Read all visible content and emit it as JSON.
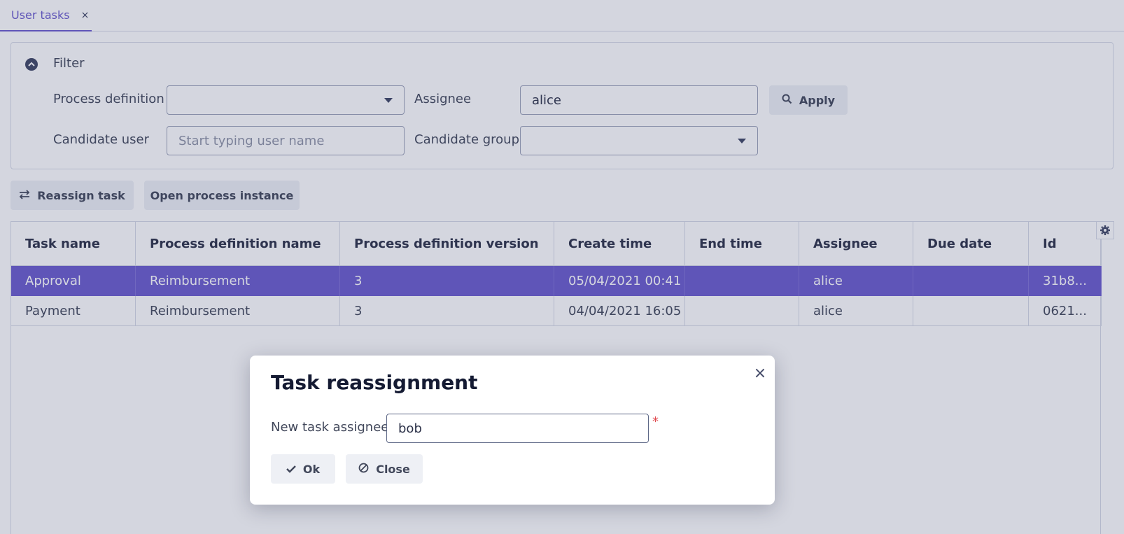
{
  "tabs": [
    {
      "label": "User tasks",
      "close": "×"
    }
  ],
  "filter": {
    "title": "Filter",
    "process_definition": {
      "label": "Process definition",
      "value": ""
    },
    "assignee": {
      "label": "Assignee",
      "value": "alice"
    },
    "apply_label": "Apply",
    "candidate_user": {
      "label": "Candidate user",
      "placeholder": "Start typing user name"
    },
    "candidate_group": {
      "label": "Candidate group",
      "value": ""
    }
  },
  "toolbar": {
    "reassign_label": "Reassign task",
    "open_instance_label": "Open process instance"
  },
  "table": {
    "columns": [
      "Task name",
      "Process definition name",
      "Process definition version",
      "Create time",
      "End time",
      "Assignee",
      "Due date",
      "Id"
    ],
    "rows": [
      [
        "Approval",
        "Reimbursement",
        "3",
        "05/04/2021 00:41",
        "",
        "alice",
        "",
        "31b8..."
      ],
      [
        "Payment",
        "Reimbursement",
        "3",
        "04/04/2021 16:05",
        "",
        "alice",
        "",
        "0621..."
      ]
    ],
    "selected_row": 0
  },
  "dialog": {
    "title": "Task reassignment",
    "close": "×",
    "field_label": "New task assignee",
    "field_value": "bob",
    "required_mark": "*",
    "ok_label": "Ok",
    "close_label": "Close"
  },
  "colors": {
    "accent": "#6a5acd",
    "required": "#e0494e"
  }
}
